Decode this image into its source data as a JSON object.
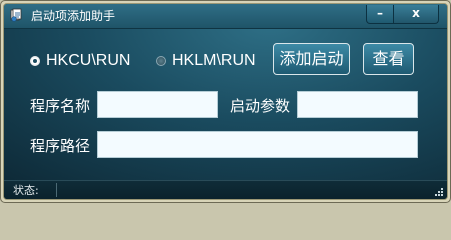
{
  "window": {
    "title": "启动项添加助手",
    "minimize_glyph": "–",
    "close_glyph": "x"
  },
  "options": {
    "hkcu_label": "HKCU\\RUN",
    "hklm_label": "HKLM\\RUN",
    "selected": "HKCU\\RUN"
  },
  "buttons": {
    "add_label": "添加启动",
    "view_label": "查看"
  },
  "form": {
    "program_name_label": "程序名称",
    "program_name_value": "",
    "params_label": "启动参数",
    "params_value": "",
    "program_path_label": "程序路径",
    "program_path_value": ""
  },
  "status": {
    "label": "状态:",
    "value": ""
  },
  "icons": {
    "app": "app-icon",
    "grip": "resize-grip-icon"
  },
  "colors": {
    "panel_gradient_top": "#2e6f86",
    "panel_gradient_bottom": "#0d2734",
    "field_background": "#f3fbff",
    "text": "#ffffff"
  }
}
